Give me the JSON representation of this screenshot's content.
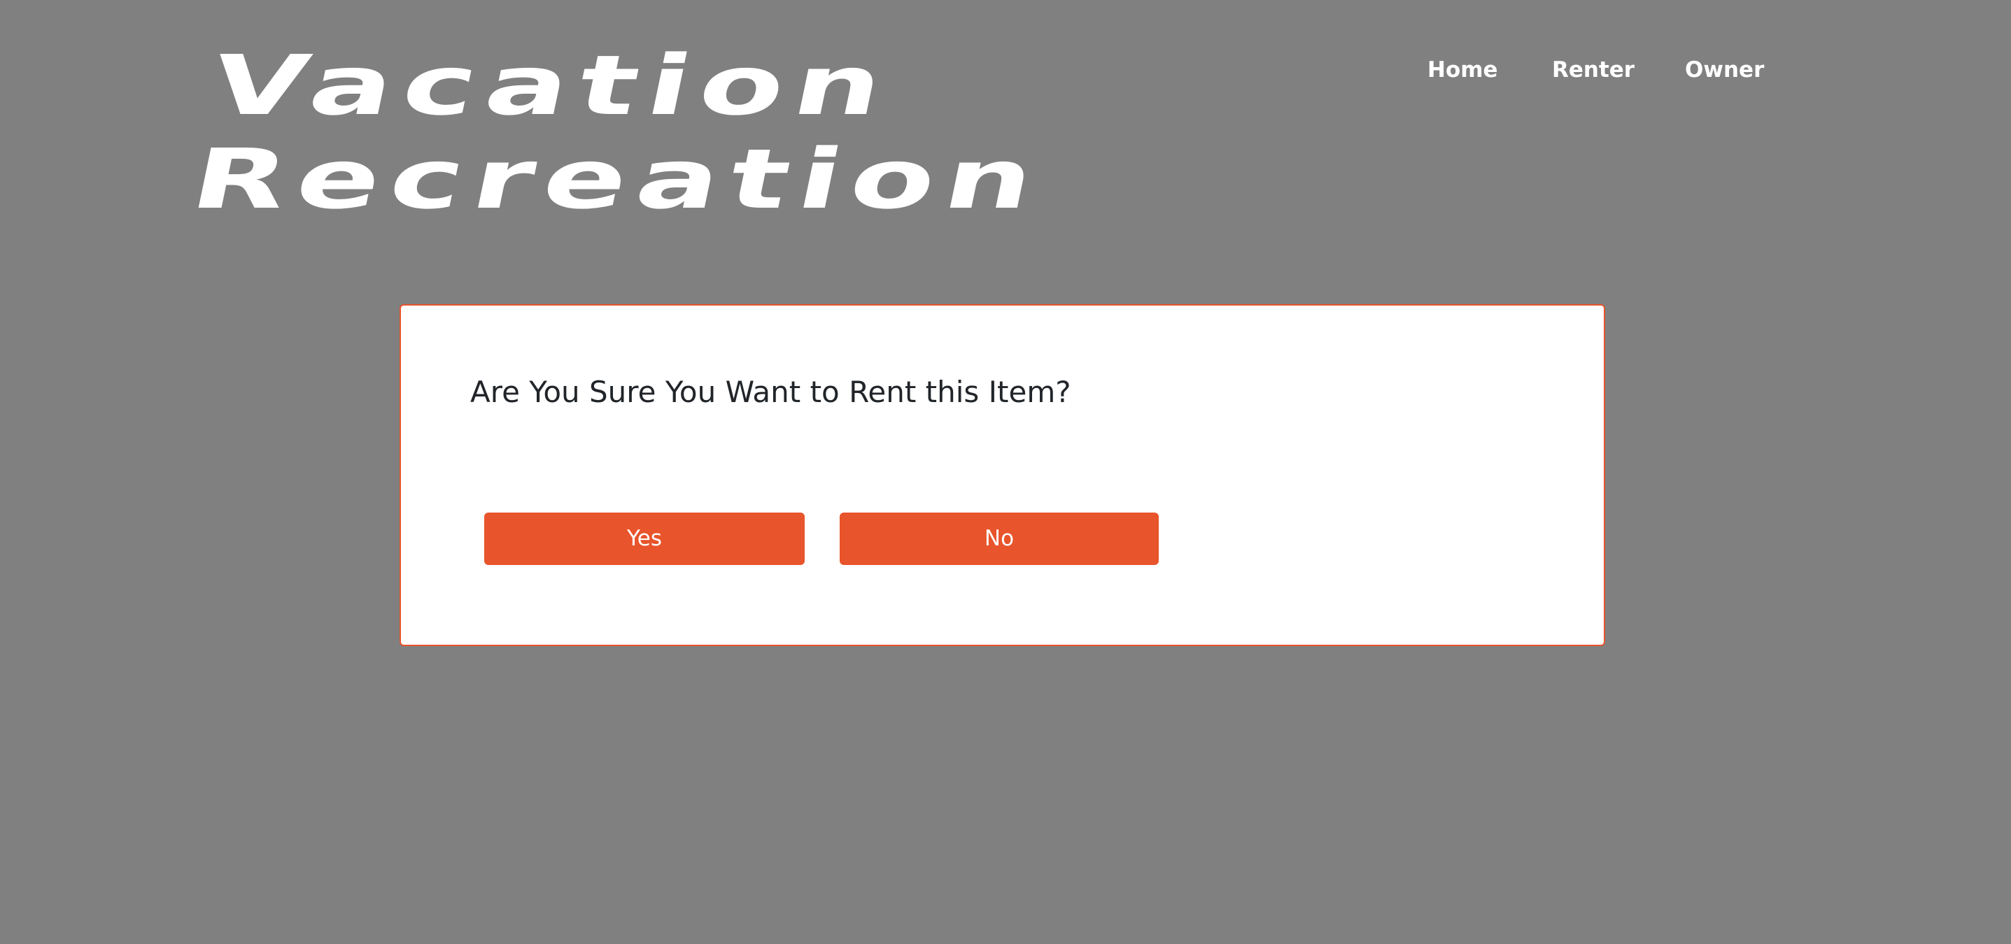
{
  "brand": {
    "line1": "Vacation",
    "line2": "Recreation"
  },
  "nav": {
    "home": "Home",
    "renter": "Renter",
    "owner": "Owner"
  },
  "dialog": {
    "title": "Are You Sure You Want to Rent this Item?",
    "yes_label": "Yes",
    "no_label": "No"
  },
  "colors": {
    "background": "#808080",
    "accent": "#e8542b",
    "dialog_bg": "#ffffff",
    "text": "#212529"
  }
}
